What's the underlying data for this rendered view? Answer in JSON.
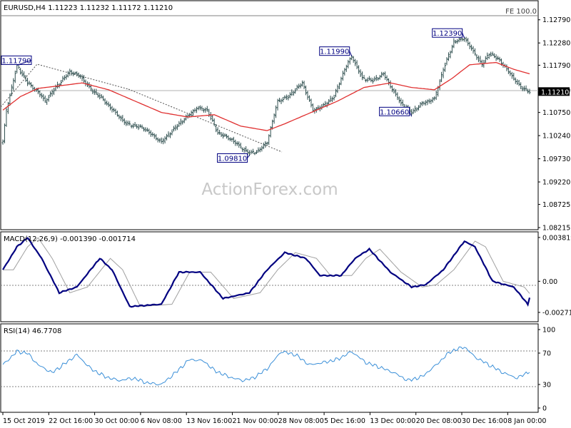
{
  "header": {
    "price_title": "EURUSD,H4  1.11223 1.11232 1.11172 1.11210",
    "fe_label": "FE 100.0",
    "macd_title": "MACD(12,26,9) -0.001390 -0.001714",
    "rsi_title": "RSI(14) 46.7708",
    "watermark": "ActionForex.com"
  },
  "colors": {
    "candle": "#2f4f4f",
    "ma": "#e03030",
    "macd_main": "#000080",
    "macd_signal": "#a0a0a0",
    "rsi": "#3a8fd8",
    "grid": "#808080",
    "current_bg": "#000000",
    "current_fg": "#ffffff"
  },
  "chart_data": [
    {
      "type": "candlestick",
      "title": "EURUSD,H4",
      "x_labels": [
        "15 Oct 2019",
        "22 Oct 16:00",
        "30 Oct 00:00",
        "6 Nov 08:00",
        "13 Nov 16:00",
        "21 Nov 00:00",
        "28 Nov 08:00",
        "5 Dec 16:00",
        "13 Dec 00:00",
        "20 Dec 08:00",
        "30 Dec 16:00",
        "8 Jan 00:00"
      ],
      "y_ticks": [
        "1.12790",
        "1.12280",
        "1.11790",
        "1.11240",
        "1.10750",
        "1.10240",
        "1.09730",
        "1.09220",
        "1.08725",
        "1.08215"
      ],
      "ylim": [
        1.082,
        1.131
      ],
      "current_price": "1.11210",
      "fe_level": 1.128,
      "annotations": [
        {
          "label": "1.11790",
          "value": 1.1179
        },
        {
          "label": "1.09810",
          "value": 1.0981
        },
        {
          "label": "1.11990",
          "value": 1.1199
        },
        {
          "label": "1.10660",
          "value": 1.1066
        },
        {
          "label": "1.12390",
          "value": 1.1239
        }
      ],
      "key_points": [
        [
          0,
          1.101
        ],
        [
          2,
          1.108
        ],
        [
          8,
          1.1179
        ],
        [
          10,
          1.1165
        ],
        [
          14,
          1.114
        ],
        [
          20,
          1.112
        ],
        [
          24,
          1.11
        ],
        [
          30,
          1.113
        ],
        [
          38,
          1.1165
        ],
        [
          44,
          1.1155
        ],
        [
          50,
          1.1125
        ],
        [
          55,
          1.111
        ],
        [
          60,
          1.109
        ],
        [
          70,
          1.105
        ],
        [
          80,
          1.104
        ],
        [
          90,
          1.101
        ],
        [
          100,
          1.105
        ],
        [
          110,
          1.1085
        ],
        [
          116,
          1.108
        ],
        [
          122,
          1.103
        ],
        [
          130,
          1.1015
        ],
        [
          136,
          1.0995
        ],
        [
          140,
          1.0985
        ],
        [
          145,
          1.099
        ],
        [
          150,
          1.101
        ],
        [
          156,
          1.11
        ],
        [
          162,
          1.111
        ],
        [
          170,
          1.114
        ],
        [
          176,
          1.108
        ],
        [
          182,
          1.109
        ],
        [
          188,
          1.111
        ],
        [
          194,
          1.117
        ],
        [
          198,
          1.1199
        ],
        [
          204,
          1.115
        ],
        [
          210,
          1.1145
        ],
        [
          216,
          1.116
        ],
        [
          222,
          1.112
        ],
        [
          226,
          1.1095
        ],
        [
          232,
          1.1075
        ],
        [
          238,
          1.1095
        ],
        [
          245,
          1.1105
        ],
        [
          250,
          1.117
        ],
        [
          256,
          1.123
        ],
        [
          262,
          1.1239
        ],
        [
          266,
          1.1215
        ],
        [
          272,
          1.118
        ],
        [
          276,
          1.1205
        ],
        [
          282,
          1.119
        ],
        [
          288,
          1.116
        ],
        [
          294,
          1.113
        ],
        [
          299,
          1.1121
        ]
      ],
      "ma_key_points": [
        [
          0,
          1.108
        ],
        [
          10,
          1.111
        ],
        [
          20,
          1.1128
        ],
        [
          35,
          1.1135
        ],
        [
          45,
          1.114
        ],
        [
          60,
          1.1125
        ],
        [
          75,
          1.11
        ],
        [
          90,
          1.1075
        ],
        [
          105,
          1.1065
        ],
        [
          120,
          1.107
        ],
        [
          135,
          1.1045
        ],
        [
          150,
          1.1035
        ],
        [
          160,
          1.105
        ],
        [
          175,
          1.1075
        ],
        [
          190,
          1.11
        ],
        [
          205,
          1.113
        ],
        [
          220,
          1.114
        ],
        [
          232,
          1.113
        ],
        [
          245,
          1.1125
        ],
        [
          255,
          1.115
        ],
        [
          265,
          1.118
        ],
        [
          280,
          1.1185
        ],
        [
          290,
          1.117
        ],
        [
          299,
          1.116
        ]
      ]
    },
    {
      "type": "line",
      "title": "MACD(12,26,9)",
      "y_ticks": [
        "0.003819",
        "0.00",
        "-0.002713"
      ],
      "ylim": [
        -0.0034,
        0.004
      ],
      "last_values": {
        "main": -0.00139,
        "signal": -0.001714
      },
      "main_key_points": [
        [
          0,
          0.001
        ],
        [
          8,
          0.003
        ],
        [
          14,
          0.0038
        ],
        [
          22,
          0.002
        ],
        [
          32,
          -0.001
        ],
        [
          42,
          -0.0005
        ],
        [
          55,
          0.002
        ],
        [
          62,
          0.001
        ],
        [
          72,
          -0.0022
        ],
        [
          90,
          -0.002
        ],
        [
          100,
          0.0008
        ],
        [
          112,
          0.0008
        ],
        [
          125,
          -0.0015
        ],
        [
          140,
          -0.001
        ],
        [
          150,
          0.001
        ],
        [
          160,
          0.0025
        ],
        [
          172,
          0.002
        ],
        [
          180,
          0.0005
        ],
        [
          192,
          0.0005
        ],
        [
          200,
          0.002
        ],
        [
          208,
          0.0028
        ],
        [
          220,
          0.0008
        ],
        [
          232,
          -0.0005
        ],
        [
          240,
          -0.0003
        ],
        [
          250,
          0.001
        ],
        [
          262,
          0.0035
        ],
        [
          268,
          0.003
        ],
        [
          278,
          0.0
        ],
        [
          290,
          -0.0005
        ],
        [
          298,
          -0.002
        ],
        [
          299,
          -0.0014
        ]
      ]
    },
    {
      "type": "line",
      "title": "RSI(14)",
      "y_ticks": [
        "100",
        "70",
        "30",
        "0"
      ],
      "ylim": [
        0,
        100
      ],
      "levels": [
        70,
        30
      ],
      "last_value": 46.7708,
      "key_points": [
        [
          0,
          55
        ],
        [
          8,
          72
        ],
        [
          14,
          70
        ],
        [
          20,
          55
        ],
        [
          28,
          45
        ],
        [
          36,
          58
        ],
        [
          42,
          68
        ],
        [
          50,
          50
        ],
        [
          58,
          40
        ],
        [
          66,
          35
        ],
        [
          74,
          38
        ],
        [
          82,
          32
        ],
        [
          90,
          30
        ],
        [
          98,
          45
        ],
        [
          106,
          62
        ],
        [
          114,
          60
        ],
        [
          120,
          48
        ],
        [
          128,
          40
        ],
        [
          136,
          35
        ],
        [
          142,
          38
        ],
        [
          150,
          50
        ],
        [
          158,
          72
        ],
        [
          166,
          68
        ],
        [
          174,
          55
        ],
        [
          182,
          58
        ],
        [
          190,
          62
        ],
        [
          198,
          72
        ],
        [
          206,
          58
        ],
        [
          214,
          52
        ],
        [
          222,
          45
        ],
        [
          230,
          35
        ],
        [
          238,
          40
        ],
        [
          246,
          55
        ],
        [
          254,
          72
        ],
        [
          262,
          78
        ],
        [
          268,
          65
        ],
        [
          276,
          55
        ],
        [
          284,
          45
        ],
        [
          292,
          38
        ],
        [
          299,
          47
        ]
      ]
    }
  ]
}
